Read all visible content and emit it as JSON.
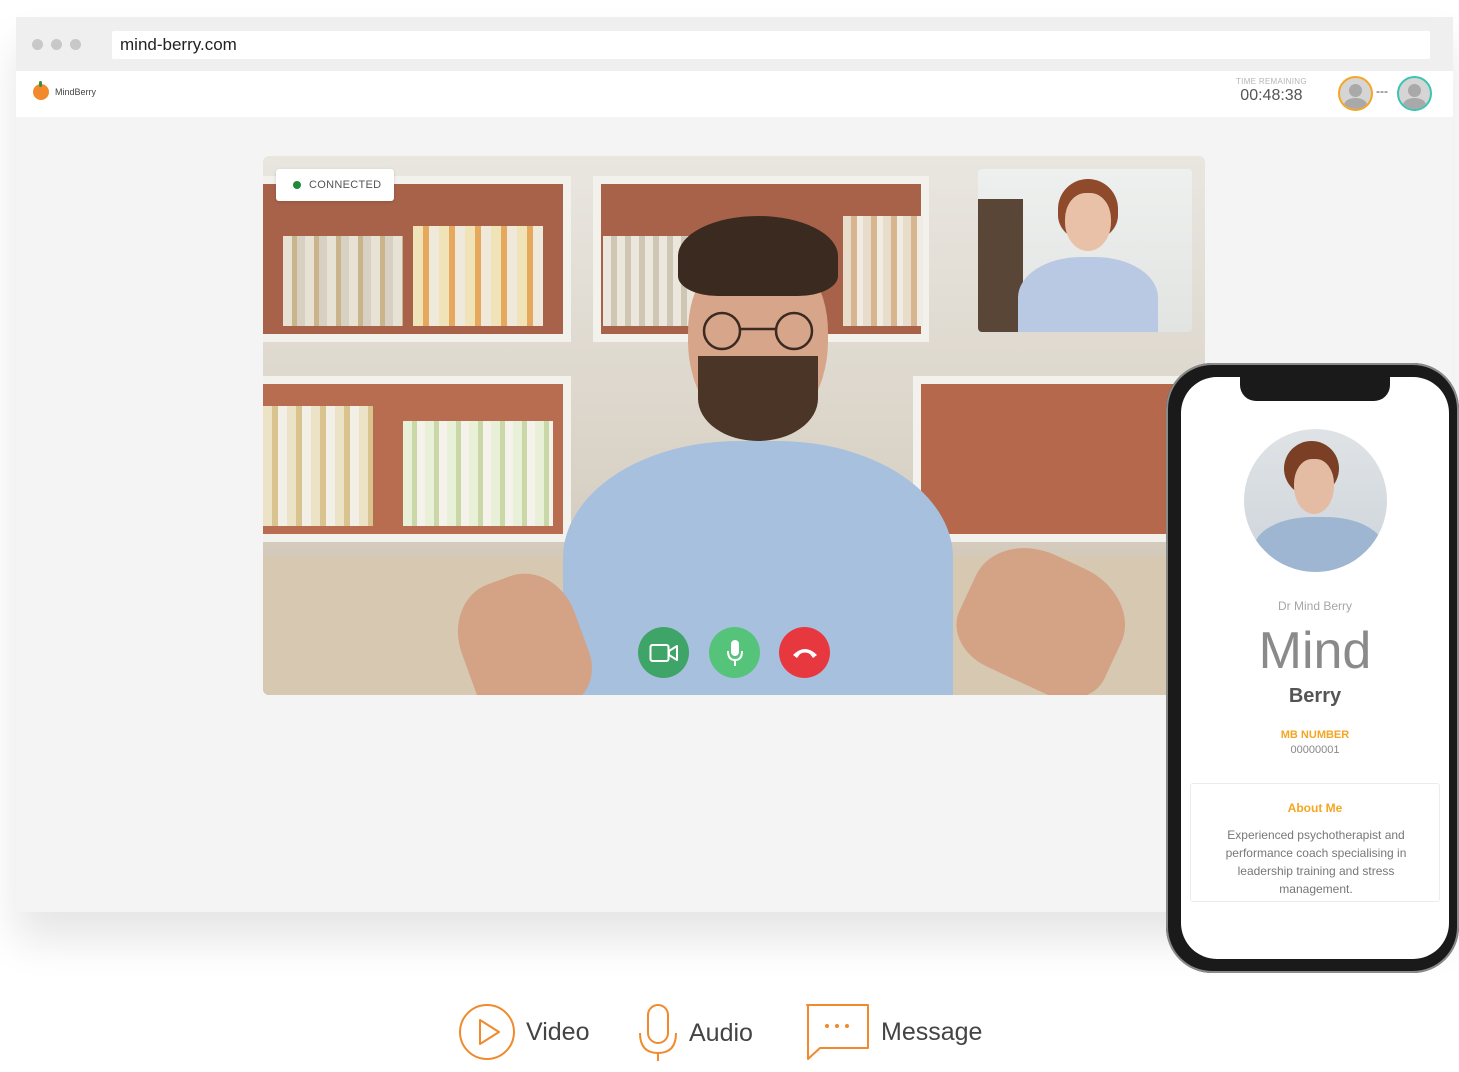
{
  "browser": {
    "url": "mind-berry.com"
  },
  "app": {
    "brand": "MindBerry",
    "timer_label": "TIME REMAINING",
    "timer_value": "00:48:38",
    "participants_separator": "---"
  },
  "call": {
    "status": "CONNECTED",
    "controls": [
      "video-camera",
      "microphone",
      "hang-up"
    ]
  },
  "profile": {
    "display_name": "Dr Mind Berry",
    "first_name": "Mind",
    "last_name": "Berry",
    "mb_label": "MB NUMBER",
    "mb_number": "00000001",
    "about_title": "About Me",
    "about_text": "Experienced psychotherapist and performance coach specialising in leadership training and stress management."
  },
  "features": [
    {
      "label": "Video",
      "icon": "play-circle-icon"
    },
    {
      "label": "Audio",
      "icon": "microphone-icon"
    },
    {
      "label": "Message",
      "icon": "chat-bubble-icon"
    }
  ],
  "colors": {
    "accent": "#f08a2c",
    "connected": "#1f8a3a",
    "video_button": "#3fa467",
    "mic_button": "#56c37a",
    "end_button": "#e8383f",
    "profile_accent": "#f5a623",
    "participant_b": "#3cc3b1"
  }
}
